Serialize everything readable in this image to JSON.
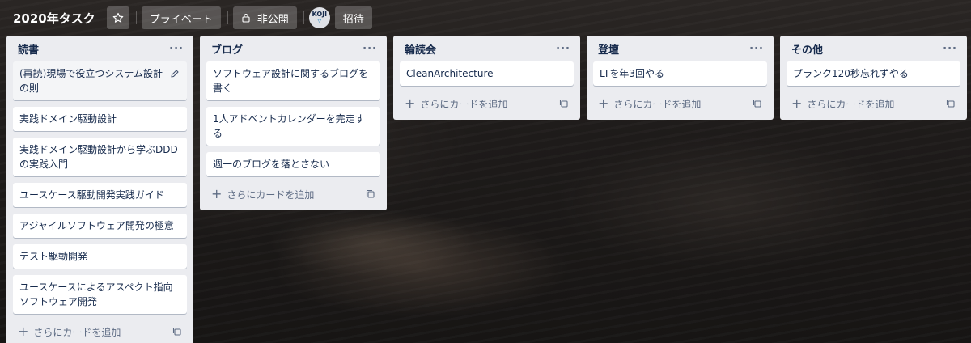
{
  "header": {
    "board_title": "2020年タスク",
    "visibility_label": "プライベート",
    "privacy_label": "非公開",
    "avatar_initials": "KOJI",
    "invite_label": "招待"
  },
  "lists": [
    {
      "title": "読書",
      "menu": "···",
      "cards": [
        "(再読)現場で役立つシステム設計の則",
        "実践ドメイン駆動設計",
        "実践ドメイン駆動設計から学ぶDDDの実践入門",
        "ユースケース駆動開発実践ガイド",
        "アジャイルソフトウェア開発の極意",
        "テスト駆動開発",
        "ユースケースによるアスペクト指向ソフトウェア開発"
      ],
      "add_label": "さらにカードを追加"
    },
    {
      "title": "ブログ",
      "menu": "···",
      "cards": [
        "ソフトウェア設計に関するブログを書く",
        "1人アドベントカレンダーを完走する",
        "週一のブログを落とさない"
      ],
      "add_label": "さらにカードを追加"
    },
    {
      "title": "輪読会",
      "menu": "···",
      "cards": [
        "CleanArchitecture"
      ],
      "add_label": "さらにカードを追加"
    },
    {
      "title": "登壇",
      "menu": "···",
      "cards": [
        "LTを年3回やる"
      ],
      "add_label": "さらにカードを追加"
    },
    {
      "title": "その他",
      "menu": "···",
      "cards": [
        "プランク120秒忘れずやる"
      ],
      "add_label": "さらにカードを追加"
    }
  ],
  "add_icon": "plus-icon",
  "template_icon": "card-template-icon",
  "edit_icon": "pencil-icon"
}
